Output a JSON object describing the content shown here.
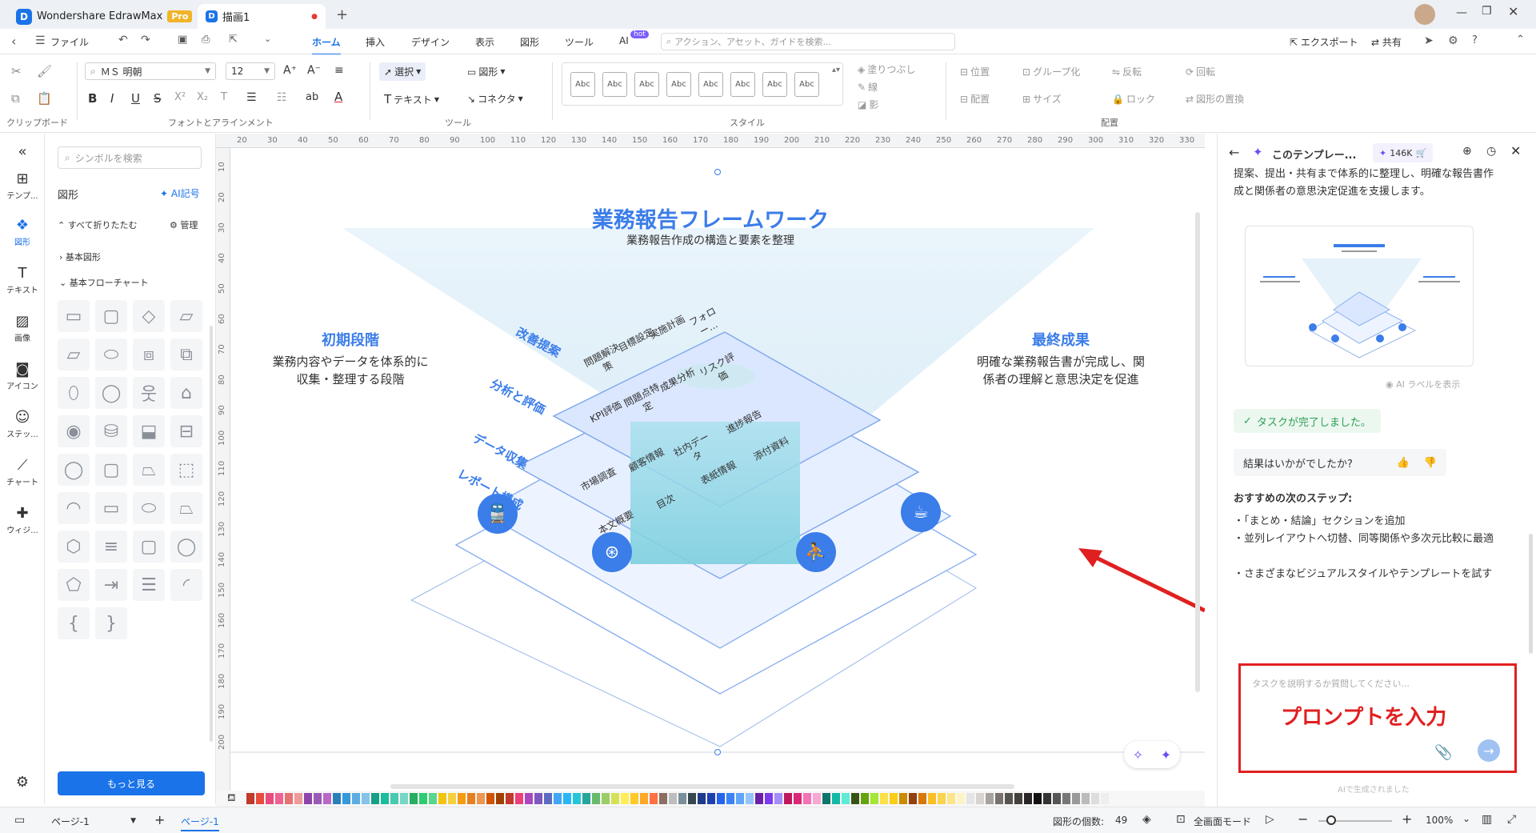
{
  "app": {
    "name": "Wondershare EdrawMax",
    "badge": "Pro",
    "doc_tab": "描画1"
  },
  "menu": {
    "file": "ファイル",
    "tabs": [
      "ホーム",
      "挿入",
      "デザイン",
      "表示",
      "図形",
      "ツール",
      "AI"
    ],
    "ai_badge": "hot",
    "search_placeholder": "アクション、アセット、ガイドを検索...",
    "export": "エクスポート",
    "share": "共有"
  },
  "ribbon": {
    "font_name": "ＭＳ 明朝",
    "font_size": "12",
    "select": "選択",
    "shape": "図形",
    "text": "テキスト",
    "connector": "コネクタ",
    "style_sample": "Abc",
    "fill": "塗りつぶし",
    "line": "線",
    "shadow": "影",
    "position": "位置",
    "group": "グループ化",
    "flip": "反転",
    "rotate": "回転",
    "align": "配置",
    "size": "サイズ",
    "lock": "ロック",
    "replace": "図形の置換",
    "groups": {
      "clipboard": "クリップボード",
      "font": "フォントとアラインメント",
      "tools": "ツール",
      "style": "スタイル",
      "arrange": "配置"
    }
  },
  "left_sidebar": {
    "items": [
      "テンプ...",
      "図形",
      "テキスト",
      "画像",
      "アイコン",
      "ステッ...",
      "チャート",
      "ウィジ..."
    ]
  },
  "shape_panel": {
    "search_placeholder": "シンボルを検索",
    "title": "図形",
    "ai_symbol": "AI記号",
    "collapse_all": "すべて折りたたむ",
    "manage": "管理",
    "category_basic": "基本図形",
    "category_flowchart": "基本フローチャート",
    "more_button": "もっと見る"
  },
  "ruler": {
    "top": [
      "20",
      "30",
      "40",
      "50",
      "60",
      "70",
      "80",
      "90",
      "100",
      "110",
      "120",
      "130",
      "140",
      "150",
      "160",
      "170",
      "180",
      "190",
      "200",
      "210",
      "220",
      "230",
      "240",
      "250",
      "260",
      "270",
      "280",
      "290",
      "300",
      "310",
      "320",
      "330"
    ],
    "left": [
      "10",
      "20",
      "30",
      "40",
      "50",
      "60",
      "70",
      "80",
      "90",
      "100",
      "110",
      "120",
      "130",
      "140",
      "150",
      "160",
      "170",
      "180",
      "190",
      "200"
    ]
  },
  "diagram": {
    "title": "業務報告フレームワーク",
    "subtitle": "業務報告作成の構造と要素を整理",
    "left_heading": "初期段階",
    "left_body": "業務内容やデータを体系的に収集・整理する段階",
    "right_heading": "最終成果",
    "right_body": "明確な業務報告書が完成し、関係者の理解と意思決定を促進",
    "layers": [
      {
        "name": "改善提案",
        "items": [
          "問題解決策",
          "目標設定",
          "実施計画",
          "フォロー..."
        ]
      },
      {
        "name": "分析と評価",
        "items": [
          "KPI評価",
          "問題点特定",
          "成果分析",
          "リスク評価"
        ]
      },
      {
        "name": "データ収集",
        "items": [
          "市場調査",
          "顧客情報",
          "社内データ",
          "進捗報告"
        ]
      },
      {
        "name": "レポート構成",
        "items": [
          "本文概要",
          "目次",
          "表紙情報",
          "添付資料"
        ]
      }
    ]
  },
  "right_panel": {
    "title": "このテンプレー...",
    "credits": "146K",
    "intro": "提案、提出・共有まで体系的に整理し、明確な報告書作成と関係者の意思決定促進を支援します。",
    "ai_label": "AI ラベルを表示",
    "task_done": "タスクが完了しました。",
    "feedback": "結果はいかがでしたか?",
    "next_steps_title": "おすすめの次のステップ:",
    "next_steps": [
      "・「まとめ・結論」セクションを追加",
      "・並列レイアウトへ切替、同等関係や多次元比較に最適",
      "・さまざまなビジュアルスタイルやテンプレートを試す"
    ],
    "prompt_placeholder": "タスクを説明するか質問してください...",
    "prompt_annotation": "プロンプトを入力",
    "footer_note": "AIで生成されました"
  },
  "status": {
    "page_select": "ページ-1",
    "page_tab": "ページ-1",
    "shape_count_label": "図形の個数:",
    "shape_count": "49",
    "fullscreen": "全画面モード",
    "zoom": "100%"
  },
  "colors": {
    "accent": "#1a73e8",
    "diagram_blue": "#3b7de9",
    "annotation_red": "#e02020"
  }
}
